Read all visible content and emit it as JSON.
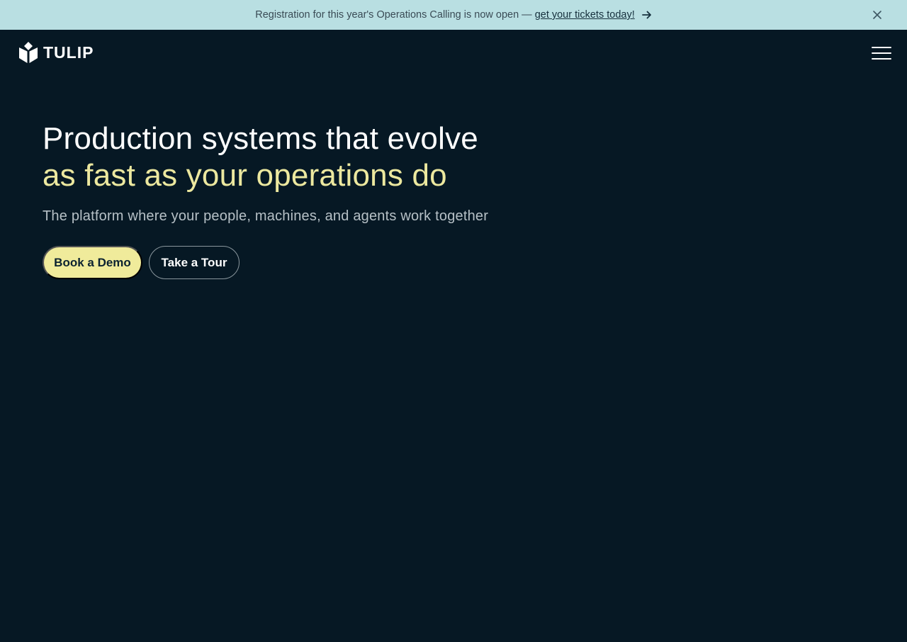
{
  "announcement": {
    "message": "Registration for this year's Operations Calling is now open —",
    "link_text": "get your tickets today!",
    "arrow_icon": "arrow-right-icon",
    "close_icon": "close-icon"
  },
  "nav": {
    "logo_text": "TULIP",
    "logo_icon": "tulip-logo-icon",
    "menu_icon": "hamburger-menu-icon"
  },
  "hero": {
    "headline_line1": "Production systems that evolve",
    "headline_line2": "as fast as your operations do",
    "subheadline": "The platform where your people, machines, and agents work together",
    "primary_button": "Book a Demo",
    "secondary_button": "Take a Tour"
  },
  "colors": {
    "background": "#061824",
    "banner": "#b9dfe2",
    "accent": "#ece89f",
    "primary_button": "#f0eb9b"
  }
}
